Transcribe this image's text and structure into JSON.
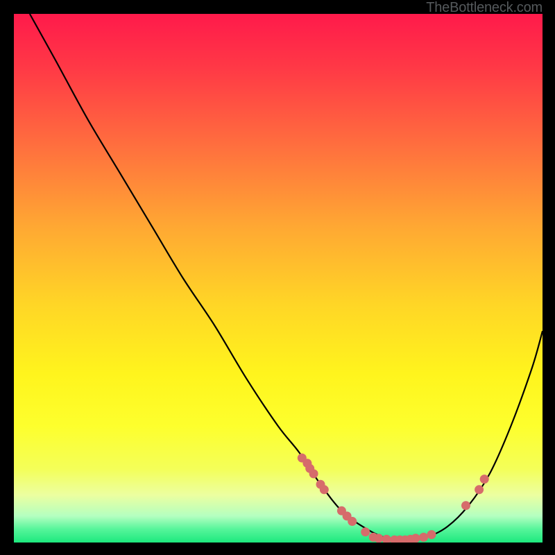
{
  "watermark": "TheBottleneck.com",
  "chart_data": {
    "type": "line",
    "title": "",
    "xlabel": "",
    "ylabel": "",
    "xlim": [
      0,
      100
    ],
    "ylim": [
      0,
      100
    ],
    "series": [
      {
        "name": "bottleneck-curve",
        "x": [
          3,
          8,
          14,
          20,
          26,
          32,
          38,
          44,
          50,
          54,
          58,
          62,
          66,
          70,
          74,
          78,
          82,
          86,
          90,
          94,
          98,
          100
        ],
        "y": [
          100,
          91,
          80,
          70,
          60,
          50,
          41,
          31,
          22,
          17,
          11,
          6,
          3,
          1,
          0.5,
          1,
          3,
          7,
          13,
          22,
          33,
          40
        ]
      }
    ],
    "markers": [
      {
        "x": 54.5,
        "y": 16
      },
      {
        "x": 55.5,
        "y": 15
      },
      {
        "x": 56.0,
        "y": 14
      },
      {
        "x": 56.7,
        "y": 13
      },
      {
        "x": 58.0,
        "y": 11
      },
      {
        "x": 58.7,
        "y": 10
      },
      {
        "x": 62.0,
        "y": 6
      },
      {
        "x": 63.0,
        "y": 5
      },
      {
        "x": 64.0,
        "y": 4
      },
      {
        "x": 66.5,
        "y": 2
      },
      {
        "x": 68.0,
        "y": 1
      },
      {
        "x": 69.0,
        "y": 0.8
      },
      {
        "x": 70.5,
        "y": 0.6
      },
      {
        "x": 72.0,
        "y": 0.5
      },
      {
        "x": 73.0,
        "y": 0.5
      },
      {
        "x": 74.0,
        "y": 0.5
      },
      {
        "x": 75.0,
        "y": 0.6
      },
      {
        "x": 76.0,
        "y": 0.8
      },
      {
        "x": 77.5,
        "y": 1
      },
      {
        "x": 79.0,
        "y": 1.5
      },
      {
        "x": 85.5,
        "y": 7
      },
      {
        "x": 88.0,
        "y": 10
      },
      {
        "x": 89.0,
        "y": 12
      }
    ],
    "gradient_stops": [
      {
        "offset": 0,
        "color": "#ff1a4b"
      },
      {
        "offset": 0.1,
        "color": "#ff3846"
      },
      {
        "offset": 0.25,
        "color": "#ff6f3e"
      },
      {
        "offset": 0.4,
        "color": "#ffa733"
      },
      {
        "offset": 0.55,
        "color": "#ffd626"
      },
      {
        "offset": 0.68,
        "color": "#fff41d"
      },
      {
        "offset": 0.78,
        "color": "#fdff2d"
      },
      {
        "offset": 0.86,
        "color": "#f4ff58"
      },
      {
        "offset": 0.91,
        "color": "#ecffa0"
      },
      {
        "offset": 0.95,
        "color": "#b4ffc0"
      },
      {
        "offset": 0.975,
        "color": "#55f59a"
      },
      {
        "offset": 1.0,
        "color": "#1de87e"
      }
    ],
    "marker_color": "#d66b6b",
    "curve_color": "#000000"
  }
}
